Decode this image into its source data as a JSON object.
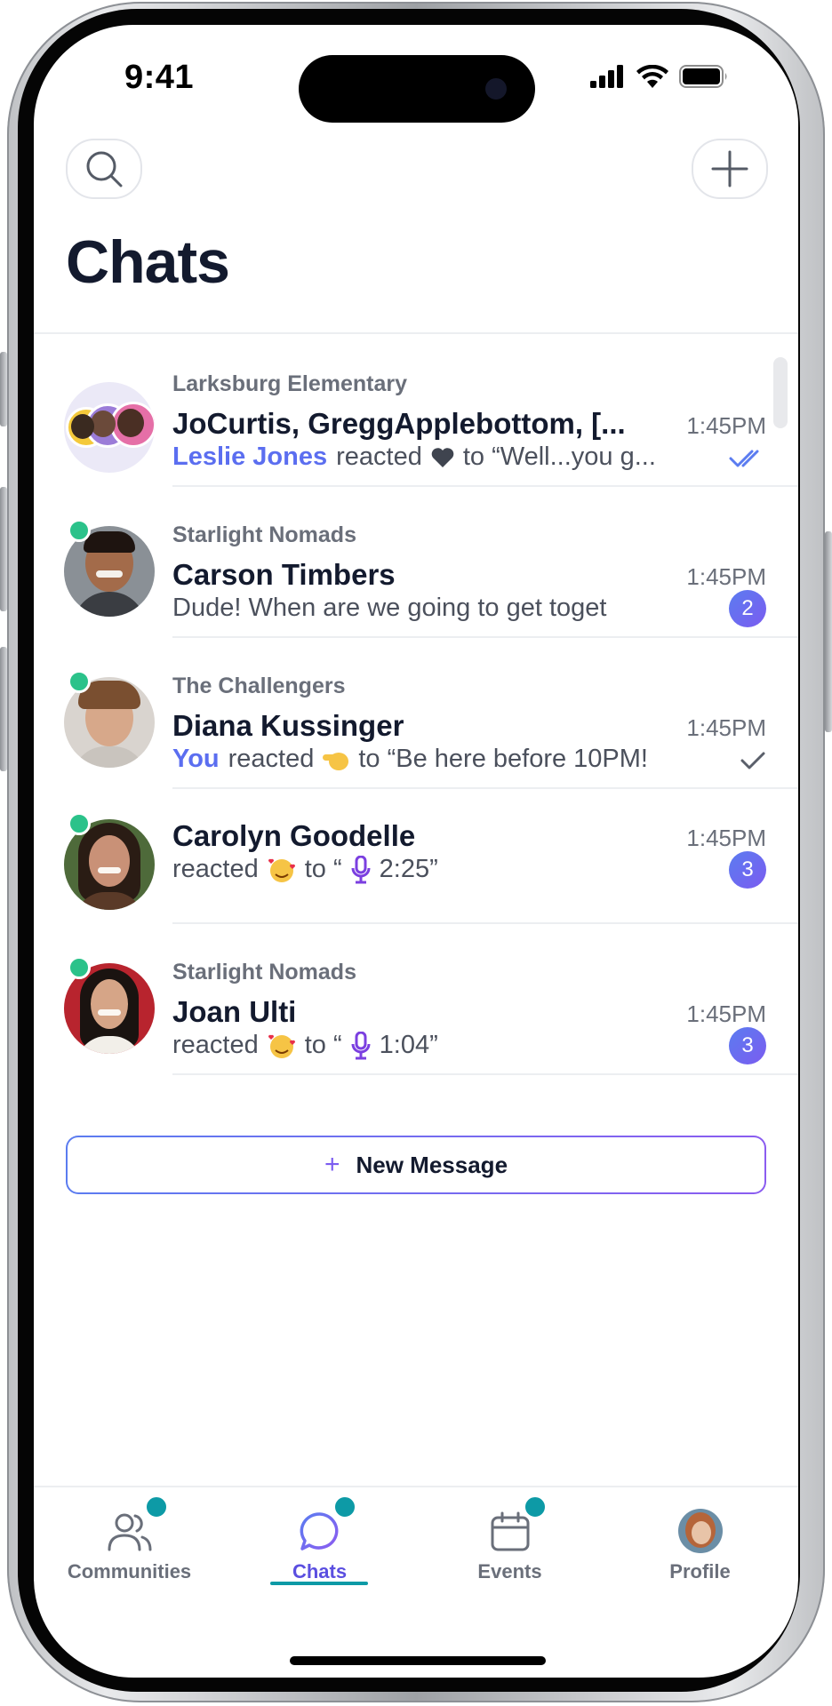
{
  "status_bar": {
    "time": "9:41"
  },
  "header": {
    "title": "Chats"
  },
  "chats": [
    {
      "group": "Larksburg Elementary",
      "name": "JoCurtis, GreggApplebottom, [...",
      "time": "1:45PM",
      "sender": "Leslie Jones",
      "reaction_text": "reacted",
      "reaction_icon": "heart-icon",
      "preview": "to “Well...you g...",
      "status": "read-double-check"
    },
    {
      "group": "Starlight Nomads",
      "name": "Carson Timbers",
      "time": "1:45PM",
      "preview": "Dude! When are we going to get toget",
      "badge": "2",
      "online": true
    },
    {
      "group": "The Challengers",
      "name": "Diana Kussinger",
      "time": "1:45PM",
      "sender": "You",
      "reaction_text": "reacted",
      "reaction_icon": "pointing-hand-emoji",
      "preview": "to “Be here before 10PM!",
      "status": "sent-check",
      "online": true
    },
    {
      "name": "Carolyn Goodelle",
      "time": "1:45PM",
      "reaction_text": "reacted",
      "reaction_icon": "smiling-hearts-emoji",
      "preview_prefix": "to “",
      "voice_icon": "microphone-icon",
      "preview": "2:25”",
      "badge": "3",
      "online": true
    },
    {
      "group": "Starlight Nomads",
      "name": "Joan Ulti",
      "time": "1:45PM",
      "reaction_text": "reacted",
      "reaction_icon": "smiling-hearts-emoji",
      "preview_prefix": "to “",
      "voice_icon": "microphone-icon",
      "preview": "1:04”",
      "badge": "3",
      "online": true
    }
  ],
  "new_message_button": {
    "label": "New Message"
  },
  "nav": {
    "tabs": [
      {
        "label": "Communities",
        "icon": "people-icon",
        "dot": true,
        "active": false
      },
      {
        "label": "Chats",
        "icon": "chat-bubble-icon",
        "dot": true,
        "active": true
      },
      {
        "label": "Events",
        "icon": "calendar-icon",
        "dot": true,
        "active": false
      },
      {
        "label": "Profile",
        "icon": "profile-avatar",
        "dot": false,
        "active": false
      }
    ]
  },
  "colors": {
    "accent": "#5b6ef0",
    "nav_active": "#0d9aa6",
    "online": "#2bc28a",
    "title": "#131a2e",
    "badge": "#6b6ef0"
  }
}
